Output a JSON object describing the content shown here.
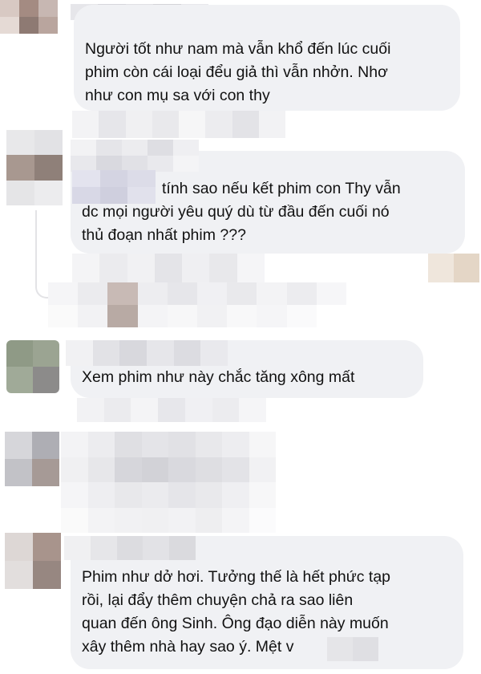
{
  "comments": [
    {
      "lines": [
        "Người tốt như nam mà vẫn khổ đến lúc cuối",
        "phim còn cái loại đểu giả thì vẫn nhởn. Nhơ",
        "như con mụ sa với con thy"
      ]
    },
    {
      "lines": [
        "tính sao nếu kết phim con Thy vẫn",
        "dc mọi người yêu quý dù từ đầu đến cuối nó",
        "thủ đoạn nhất phim ???"
      ]
    },
    {
      "lines": [
        "Xem phim như này chắc tăng xông mất"
      ]
    },
    {
      "lines": []
    },
    {
      "lines": [
        "Phim như dở hơi. Tưởng thế là hết phức tạp",
        "rồi, lại đẩy thêm chuyện chả ra sao liên",
        "quan đến ông Sinh. Ông đạo diễn này muốn",
        "xây thêm nhà hay sao ý. Mệt v"
      ]
    }
  ],
  "colors": {
    "bubble": "#f0f1f4",
    "text": "#111111",
    "thread_line": "#e3e3e6",
    "pixelated": "#d9d9de"
  }
}
